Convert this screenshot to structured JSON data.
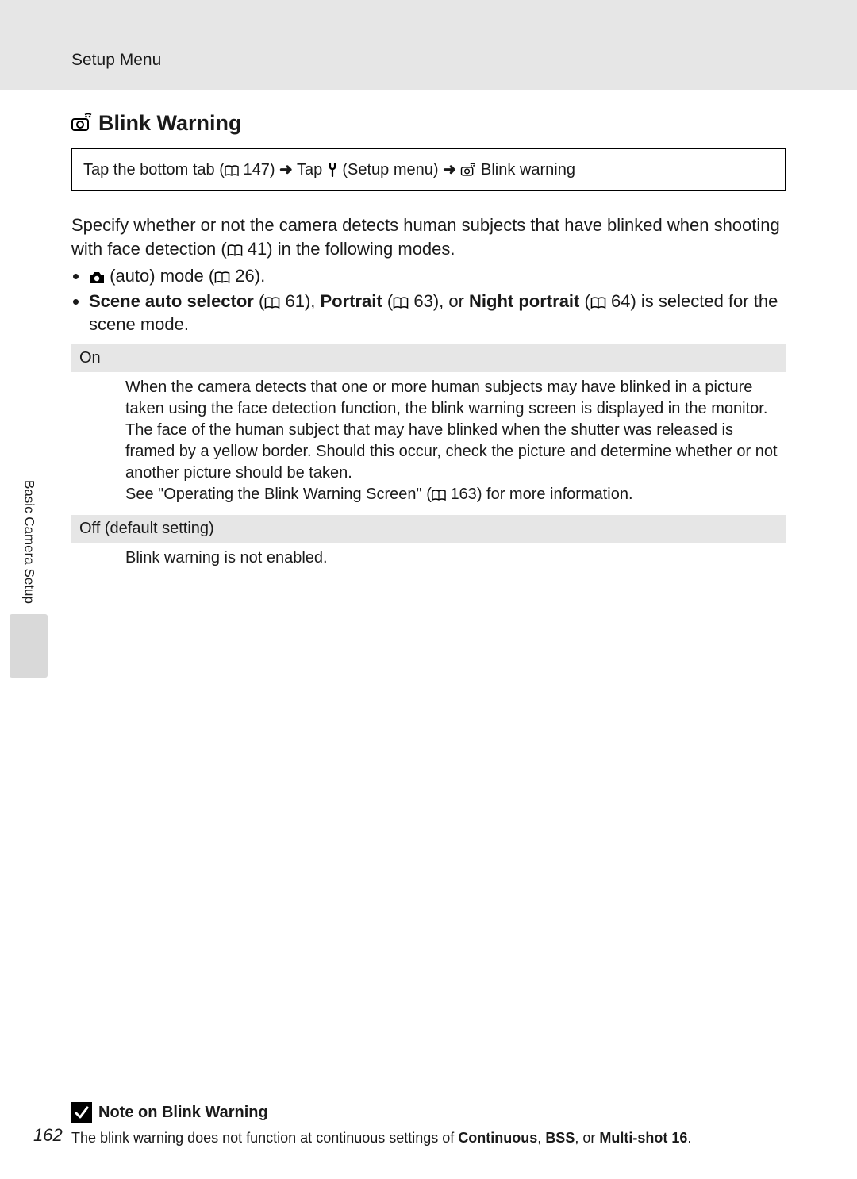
{
  "header": {
    "breadcrumb": "Setup Menu"
  },
  "section": {
    "title": "Blink Warning"
  },
  "nav": {
    "text_1": "Tap the bottom tab (",
    "ref_1": "147",
    "text_2": ") ",
    "text_3": " Tap ",
    "text_4": " (Setup menu) ",
    "text_5": " Blink warning"
  },
  "intro": {
    "p1": "Specify whether or not the camera detects human subjects that have blinked when shooting with face detection (",
    "p1_ref": "41",
    "p1_tail": ") in the following modes."
  },
  "bullets": {
    "b1_pre": " (auto) mode (",
    "b1_ref": "26",
    "b1_tail": ").",
    "b2_s1": "Scene auto selector",
    "b2_t1": " (",
    "b2_r1": "61",
    "b2_t2": "), ",
    "b2_s2": "Portrait",
    "b2_t3": " (",
    "b2_r2": "63",
    "b2_t4": "), or ",
    "b2_s3": "Night portrait",
    "b2_t5": " (",
    "b2_r3": "64",
    "b2_t6": ") is selected for the scene mode."
  },
  "options": {
    "on_label": "On",
    "on_desc_1": "When the camera detects that one or more human subjects may have blinked in a picture taken using the face detection function, the blink warning screen is displayed in the monitor.",
    "on_desc_2": "The face of the human subject that may have blinked when the shutter was released is framed by a yellow border. Should this occur, check the picture and determine whether or not another picture should be taken.",
    "on_desc_3a": "See \"Operating the Blink Warning Screen\" (",
    "on_desc_3_ref": "163",
    "on_desc_3b": ") for more information.",
    "off_label": "Off (default setting)",
    "off_desc": "Blink warning is not enabled."
  },
  "side": {
    "label": "Basic Camera Setup"
  },
  "note": {
    "title": "Note on Blink Warning",
    "text_1": "The blink warning does not function at continuous settings of ",
    "b1": "Continuous",
    "text_2": ", ",
    "b2": "BSS",
    "text_3": ", or ",
    "b3": "Multi-shot 16",
    "text_4": "."
  },
  "page_number": "162"
}
